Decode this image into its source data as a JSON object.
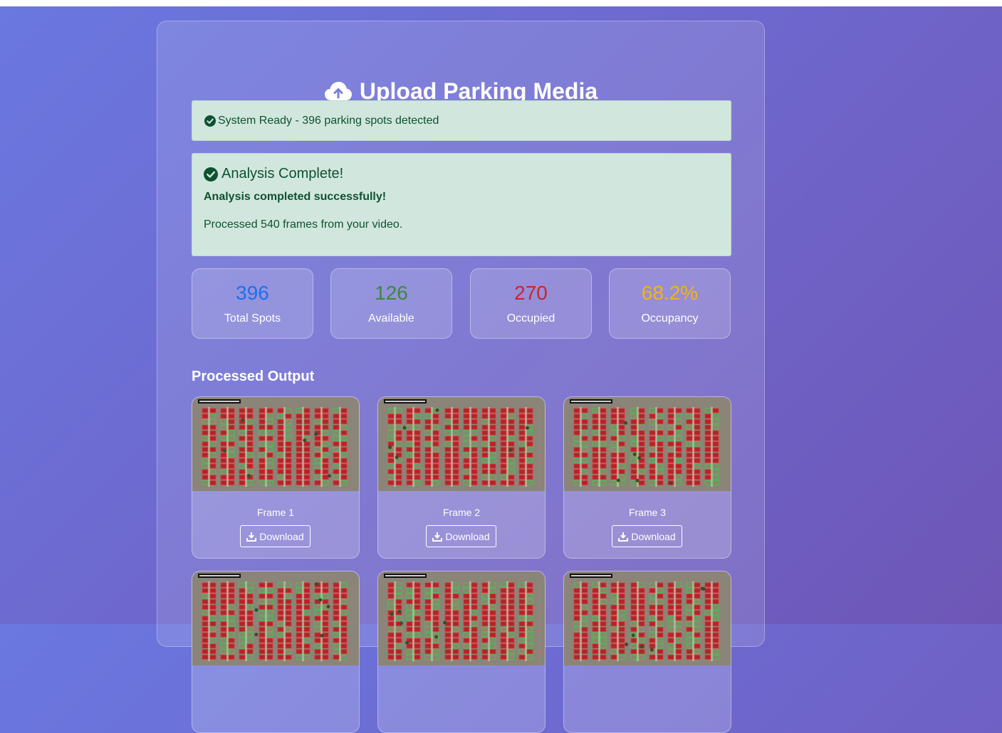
{
  "page": {
    "title": "Upload Parking Media",
    "title_icon": "cloud-upload-icon"
  },
  "status_alert": {
    "icon": "check-circle-icon",
    "text": "System Ready - 396 parking spots detected"
  },
  "result_alert": {
    "icon": "check-circle-icon",
    "heading": "Analysis Complete!",
    "bold_text": "Analysis completed successfully!",
    "text": "Processed 540 frames from your video."
  },
  "stats": [
    {
      "value": "396",
      "label": "Total Spots",
      "color": "#1f6feb"
    },
    {
      "value": "126",
      "label": "Available",
      "color": "#3a8a3a"
    },
    {
      "value": "270",
      "label": "Occupied",
      "color": "#c8252d"
    },
    {
      "value": "68.2%",
      "label": "Occupancy",
      "color": "#f3b317"
    }
  ],
  "output": {
    "heading": "Processed Output",
    "frames": [
      {
        "label": "Frame 1",
        "button": "Download"
      },
      {
        "label": "Frame 2",
        "button": "Download"
      },
      {
        "label": "Frame 3",
        "button": "Download"
      },
      {
        "label": "",
        "button": ""
      },
      {
        "label": "",
        "button": ""
      },
      {
        "label": "",
        "button": ""
      }
    ]
  },
  "colors": {
    "alert_bg": "#d1e7dd",
    "alert_text": "#0f5132"
  }
}
